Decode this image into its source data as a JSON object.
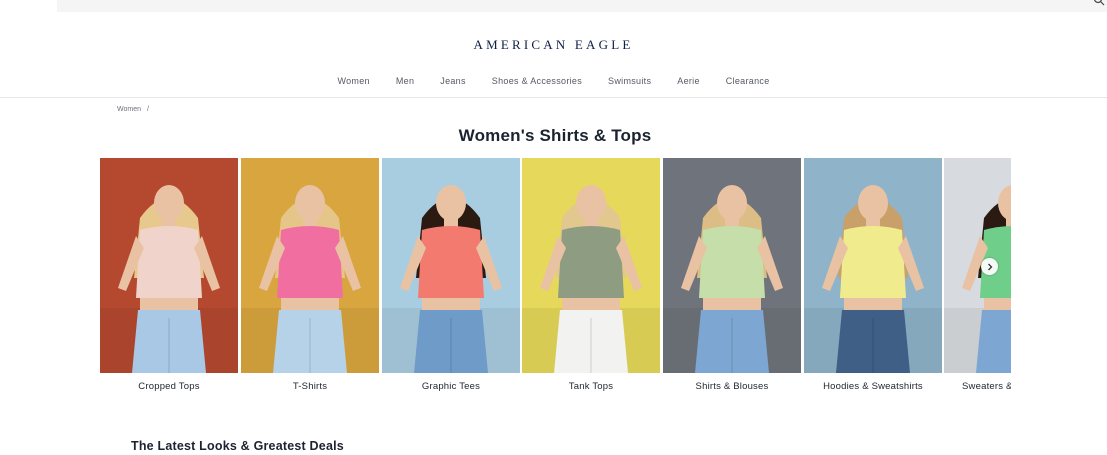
{
  "brand": {
    "logo_text": "AMERICAN EAGLE"
  },
  "nav": {
    "items": [
      {
        "label": "Women"
      },
      {
        "label": "Men"
      },
      {
        "label": "Jeans"
      },
      {
        "label": "Shoes & Accessories"
      },
      {
        "label": "Swimsuits"
      },
      {
        "label": "Aerie"
      },
      {
        "label": "Clearance"
      }
    ]
  },
  "breadcrumb": {
    "item": "Women",
    "separator": "/"
  },
  "page_title": "Women's Shirts & Tops",
  "categories": [
    {
      "label": "Cropped Tops",
      "bg": "#b5492f",
      "top": "#f0d4cc",
      "hair": "#e8c98d",
      "bottom": "#a8c8e6"
    },
    {
      "label": "T-Shirts",
      "bg": "#d9a53e",
      "top": "#f16fa0",
      "hair": "#e6c688",
      "bottom": "#b6d2e8"
    },
    {
      "label": "Graphic Tees",
      "bg": "#a9cde0",
      "top": "#f37a6e",
      "hair": "#2b1a12",
      "bottom": "#6f9bc8"
    },
    {
      "label": "Tank Tops",
      "bg": "#e6d85a",
      "top": "#8e9d82",
      "hair": "#e2c88e",
      "bottom": "#f2f2f0"
    },
    {
      "label": "Shirts & Blouses",
      "bg": "#6f747c",
      "top": "#c5deaa",
      "hair": "#dbbd85",
      "bottom": "#7ea6d2"
    },
    {
      "label": "Hoodies & Sweatshirts",
      "bg": "#8fb3c9",
      "top": "#f0ec8e",
      "hair": "#c9a06a",
      "bottom": "#3f5f86"
    },
    {
      "label": "Sweaters & Cardigans",
      "bg": "#d7dbdf",
      "top": "#6fcf8a",
      "hair": "#2a1a12",
      "bottom": "#7ea6d2"
    }
  ],
  "carousel": {
    "next_icon": "chevron-right-icon"
  },
  "section_title": "The Latest Looks & Greatest Deals"
}
